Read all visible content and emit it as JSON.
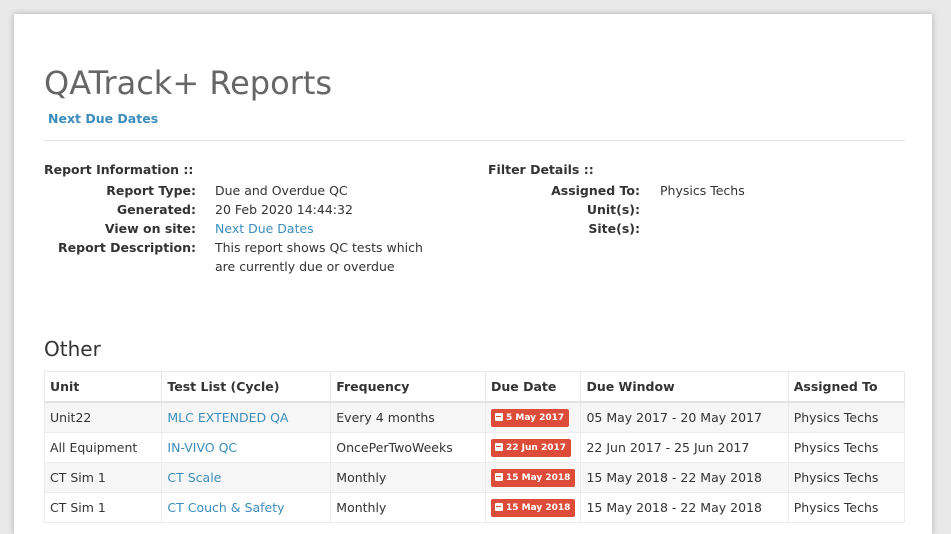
{
  "header": {
    "title": "QATrack+ Reports",
    "report_link": "Next Due Dates"
  },
  "report_info": {
    "heading": "Report Information ::",
    "rows": [
      {
        "label": "Report Type:",
        "value": "Due and Overdue QC"
      },
      {
        "label": "Generated:",
        "value": "20 Feb 2020 14:44:32"
      },
      {
        "label": "View on site:",
        "value": "Next Due Dates"
      },
      {
        "label": "Report Description:",
        "value": "This report shows QC tests which are currently due or overdue"
      }
    ]
  },
  "filter_details": {
    "heading": "Filter Details ::",
    "rows": [
      {
        "label": "Assigned To:",
        "value": "Physics Techs"
      },
      {
        "label": "Unit(s):",
        "value": ""
      },
      {
        "label": "Site(s):",
        "value": ""
      }
    ]
  },
  "section": {
    "title": "Other",
    "columns": [
      "Unit",
      "Test List (Cycle)",
      "Frequency",
      "Due Date",
      "Due Window",
      "Assigned To"
    ],
    "rows": [
      {
        "unit": "Unit22",
        "test_list": "MLC EXTENDED QA",
        "frequency": "Every 4 months",
        "due_date": "5 May 2017",
        "due_window": "05 May 2017 - 20 May 2017",
        "assigned_to": "Physics Techs"
      },
      {
        "unit": "All Equipment",
        "test_list": "IN-VIVO QC",
        "frequency": "OncePerTwoWeeks",
        "due_date": "22 Jun 2017",
        "due_window": "22 Jun 2017 - 25 Jun 2017",
        "assigned_to": "Physics Techs"
      },
      {
        "unit": "CT Sim 1",
        "test_list": "CT Scale",
        "frequency": "Monthly",
        "due_date": "15 May 2018",
        "due_window": "15 May 2018 - 22 May 2018",
        "assigned_to": "Physics Techs"
      },
      {
        "unit": "CT Sim 1",
        "test_list": "CT Couch & Safety",
        "frequency": "Monthly",
        "due_date": "15 May 2018",
        "due_window": "15 May 2018 - 22 May 2018",
        "assigned_to": "Physics Techs"
      }
    ]
  },
  "colors": {
    "link": "#3c8dbc",
    "overdue_badge": "#dd4b39",
    "title": "#666666"
  },
  "icons": {
    "overdue_badge_icon": "minus-square-icon"
  }
}
